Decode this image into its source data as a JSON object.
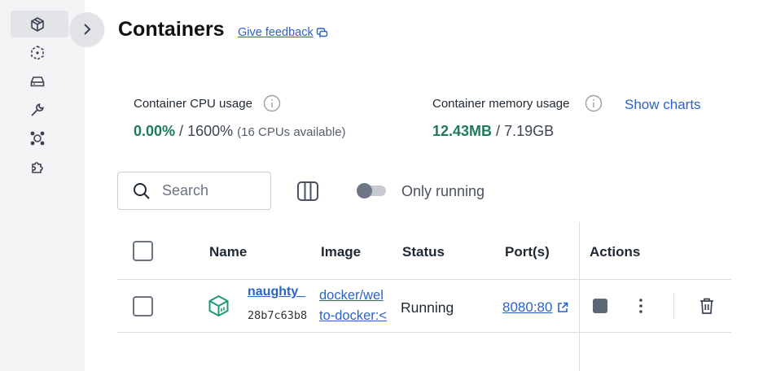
{
  "sidebar": {
    "items": [
      {
        "icon": "containers-icon",
        "active": true
      },
      {
        "icon": "images-icon"
      },
      {
        "icon": "volumes-icon"
      },
      {
        "icon": "builds-icon"
      },
      {
        "icon": "scout-icon"
      },
      {
        "icon": "extensions-icon"
      }
    ],
    "collapse_icon": "chevron-right-icon"
  },
  "header": {
    "title": "Containers",
    "feedback_label": "Give feedback"
  },
  "stats": {
    "cpu_label": "Container CPU usage",
    "cpu_used": "0.00%",
    "cpu_sep": " / ",
    "cpu_total": "1600%",
    "cpu_note": "(16 CPUs available)",
    "memory_label": "Container memory usage",
    "memory_used": "12.43MB",
    "memory_sep": " / ",
    "memory_total": "7.19GB",
    "show_charts": "Show charts"
  },
  "toolbar": {
    "search_placeholder": "Search",
    "only_running_label": "Only running",
    "only_running_on": false
  },
  "table": {
    "columns": [
      "Name",
      "Image",
      "Status",
      "Port(s)",
      "Actions"
    ],
    "rows": [
      {
        "name": "naughty_",
        "id": "28b7c63b8",
        "image_line1": "docker/wel",
        "image_line2": "to-docker:<",
        "status": "Running",
        "port": "8080:80"
      }
    ]
  },
  "colors": {
    "accent": "#2b63c6",
    "green": "#1f7a5c",
    "sidebar_bg": "#f4f4f6"
  }
}
